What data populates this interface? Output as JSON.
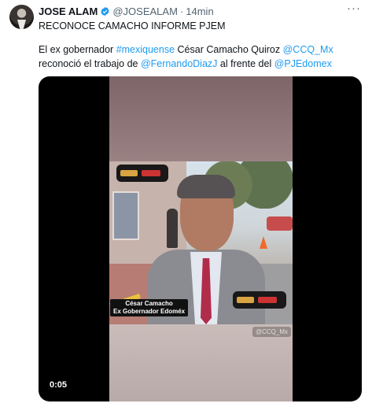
{
  "tweet": {
    "author_name": "JOSE ALAM",
    "handle": "@JOSEALAM",
    "separator": "·",
    "time": "14min",
    "more_glyph": "···",
    "headline": "RECONOCE CAMACHO INFORME PJEM",
    "body": {
      "p1_text": "El ex gobernador ",
      "p1_hashtag": "#mexiquense",
      "p1_mid": " César Camacho Quiroz ",
      "p1_mention": "@CCQ_Mx",
      "p2_text": "reconoció el trabajo de ",
      "p2_mention1": "@FernandoDiazJ",
      "p2_mid": " al frente del ",
      "p2_mention2": "@PJEdomex"
    }
  },
  "media": {
    "caption_line1": "César Camacho",
    "caption_line2": "Ex Gobernador Edoméx",
    "watermark": "@CCQ_Mx",
    "duration": "0:05"
  },
  "colors": {
    "link": "#1d9bf0",
    "verified": "#1d9bf0",
    "text": "#0f1419",
    "muted": "#536471"
  },
  "icons": {
    "verified": "verified-badge-icon",
    "more": "more-options-icon"
  }
}
